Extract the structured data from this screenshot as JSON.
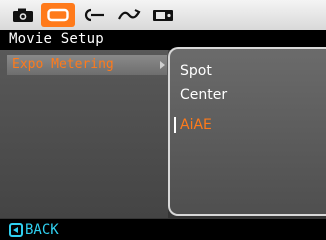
{
  "mode_bar": {
    "icons": [
      "camera-icon",
      "movie-icon",
      "playback-icon",
      "effect-icon",
      "setup-icon"
    ],
    "active_index": 1,
    "accent_color": "#ff7a1a"
  },
  "title": "Movie Setup",
  "menu": {
    "items": [
      {
        "label": "Expo Metering",
        "selected": true
      }
    ]
  },
  "submenu": {
    "options": [
      {
        "label": "Spot",
        "selected": false
      },
      {
        "label": "Center",
        "selected": false
      },
      {
        "label": "AiAE",
        "selected": true
      }
    ]
  },
  "footer": {
    "back_label": "BACK",
    "back_icon": "back-key-icon",
    "color": "#30d0f0"
  }
}
